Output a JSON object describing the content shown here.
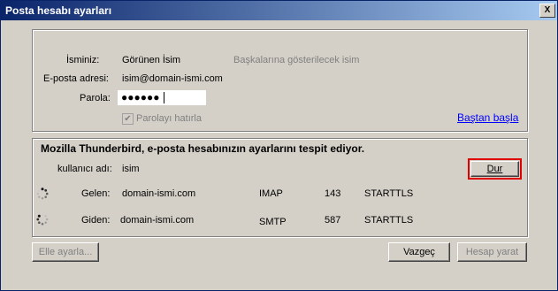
{
  "window": {
    "title": "Posta hesabı ayarları",
    "close_glyph": "X"
  },
  "account": {
    "name_label": "İsminiz:",
    "name_value": "Görünen İsim",
    "name_hint": "Başkalarına gösterilecek isim",
    "email_label": "E-posta adresi:",
    "email_value": "isim@domain-ismi.com",
    "password_label": "Parola:",
    "password_mask": "●●●●●●",
    "remember_label": "Parolayı hatırla",
    "remember_checked": true,
    "restart_link": "Baştan başla"
  },
  "detect": {
    "status": "Mozilla Thunderbird, e-posta hesabınızın ayarlarını tespit ediyor.",
    "username_label": "kullanıcı adı:",
    "username_value": "isim",
    "stop_button": "Dur",
    "incoming": {
      "label": "Gelen:",
      "server": "domain-ismi.com",
      "protocol": "IMAP",
      "port": "143",
      "security": "STARTTLS"
    },
    "outgoing": {
      "label": "Giden:",
      "server": "domain-ismi.com",
      "protocol": "SMTP",
      "port": "587",
      "security": "STARTTLS"
    }
  },
  "footer": {
    "manual_button": "Elle ayarla...",
    "cancel_button": "Vazgeç",
    "create_button": "Hesap yarat"
  }
}
